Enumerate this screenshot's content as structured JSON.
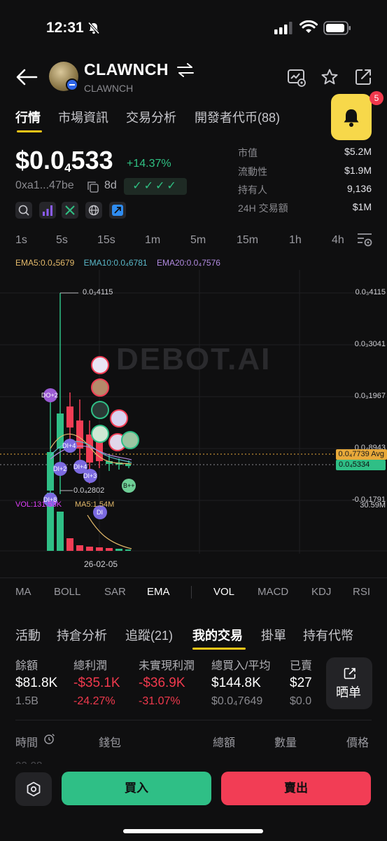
{
  "status_bar": {
    "time": "12:31"
  },
  "header": {
    "token_name": "CLAWNCH",
    "token_sub": "CLAWNCH"
  },
  "main_tabs": [
    {
      "label": "行情",
      "active": true
    },
    {
      "label": "市場資訊"
    },
    {
      "label": "交易分析"
    },
    {
      "label": "開發者代币(88)"
    }
  ],
  "alert": {
    "count": "5"
  },
  "price": {
    "prefix": "$0.0",
    "sub": "4",
    "suffix": "533",
    "change": "+14.37%",
    "address": "0xa1...47be",
    "age": "8d",
    "checks": "✓✓✓✓"
  },
  "stats": [
    {
      "label": "市值",
      "value": "$5.2M"
    },
    {
      "label": "流動性",
      "value": "$1.9M"
    },
    {
      "label": "持有人",
      "value": "9,136"
    },
    {
      "label": "24H 交易額",
      "value": "$1M"
    }
  ],
  "timeframes": [
    "1s",
    "5s",
    "15s",
    "1m",
    "5m",
    "15m",
    "1h",
    "4h"
  ],
  "ema": {
    "ema5": "EMA5:0.0₄5679",
    "ema10": "EMA10:0.0₄6781",
    "ema20": "EMA20:0.0₄7576"
  },
  "chart": {
    "watermark": "DEBOT.AI",
    "high_label": "0.0₃4115",
    "low_label": "0.0₄2802",
    "y_labels": [
      "0.0₃4115",
      "0.0₃3041",
      "0.0₃1967",
      "0.0₄8943",
      "-0.0₄1791"
    ],
    "avg_tag": "0.0₄7739 Avg",
    "current_tag": "0.0₄5334",
    "vol_label": "VOL:131.53K",
    "ma5_label": "MA5:1.54M",
    "vol_axis": "30.59M",
    "date_label": "26-02-05",
    "markers": [
      "DO+2",
      "DI+4",
      "DI+2",
      "DI+4",
      "DI+3",
      "DI+8",
      "DI",
      "B++"
    ]
  },
  "chart_data": {
    "type": "candlestick",
    "title": "",
    "x": [
      "26-02-05"
    ],
    "ema_values": {
      "EMA5": "0.0₄5679",
      "EMA10": "0.0₄6781",
      "EMA20": "0.0₄7576"
    },
    "y_ticks": [
      "0.0₃4115",
      "0.0₃3041",
      "0.0₃1967",
      "0.0₄8943",
      "-0.0₄1791"
    ],
    "series": [
      {
        "name": "VOL",
        "values": [
          131530
        ]
      },
      {
        "name": "MA5",
        "values": [
          1540000
        ]
      }
    ]
  },
  "indicator_tabs": [
    "MA",
    "BOLL",
    "SAR",
    "EMA",
    "VOL",
    "MACD",
    "KDJ",
    "RSI"
  ],
  "bottom_tabs": [
    {
      "label": "活動"
    },
    {
      "label": "持倉分析"
    },
    {
      "label": "追蹤(21)"
    },
    {
      "label": "我的交易",
      "active": true
    },
    {
      "label": "掛單"
    },
    {
      "label": "持有代幣"
    }
  ],
  "metrics": [
    {
      "label": "餘額",
      "value": "$81.8K",
      "sub": "1.5B"
    },
    {
      "label": "總利潤",
      "value": "-$35.1K",
      "sub": "-24.27%",
      "negative": true
    },
    {
      "label": "未實現利潤",
      "value": "-$36.9K",
      "sub": "-31.07%",
      "negative": true
    },
    {
      "label": "總買入/平均",
      "value": "$144.8K",
      "sub": "$0.0₄7649"
    },
    {
      "label": "已賣",
      "value": "$27",
      "sub": "$0.0"
    }
  ],
  "share_trade_label": "晒单",
  "table_headers": [
    "時間",
    "錢包",
    "總額",
    "數量",
    "價格"
  ],
  "partial_row": "02-08",
  "buy_label": "買入",
  "sell_label": "賣出",
  "colors": {
    "accent": "#f5c518",
    "up": "#2fbf86",
    "down": "#f23d55",
    "bg": "#0f0f10"
  }
}
